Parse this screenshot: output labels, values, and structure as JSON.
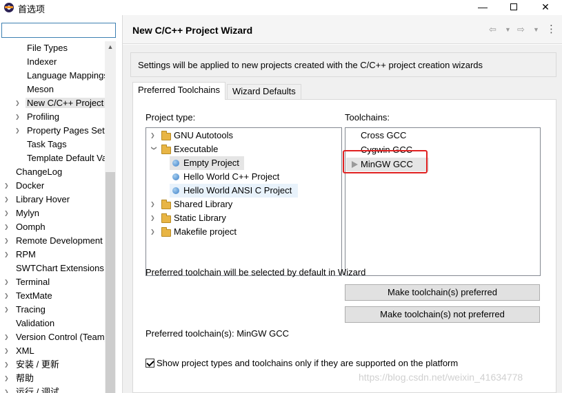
{
  "window": {
    "title": "首选项",
    "minimize_glyph": "—",
    "close_glyph": "✕"
  },
  "filter": {
    "value": "",
    "placeholder": ""
  },
  "sidebar": {
    "items": [
      {
        "label": "File Types",
        "indent": 1,
        "arrow": "",
        "selected": false
      },
      {
        "label": "Indexer",
        "indent": 1,
        "arrow": "",
        "selected": false
      },
      {
        "label": "Language Mappings",
        "indent": 1,
        "arrow": "",
        "selected": false
      },
      {
        "label": "Meson",
        "indent": 1,
        "arrow": "",
        "selected": false
      },
      {
        "label": "New C/C++ Project Wizard",
        "indent": 1,
        "arrow": ">",
        "selected": true
      },
      {
        "label": "Profiling",
        "indent": 1,
        "arrow": ">",
        "selected": false
      },
      {
        "label": "Property Pages Settings",
        "indent": 1,
        "arrow": ">",
        "selected": false
      },
      {
        "label": "Task Tags",
        "indent": 1,
        "arrow": "",
        "selected": false
      },
      {
        "label": "Template Default Values",
        "indent": 1,
        "arrow": "",
        "selected": false
      },
      {
        "label": "ChangeLog",
        "indent": 0,
        "arrow": "",
        "selected": false
      },
      {
        "label": "Docker",
        "indent": 0,
        "arrow": ">",
        "selected": false
      },
      {
        "label": "Library Hover",
        "indent": 0,
        "arrow": ">",
        "selected": false
      },
      {
        "label": "Mylyn",
        "indent": 0,
        "arrow": ">",
        "selected": false
      },
      {
        "label": "Oomph",
        "indent": 0,
        "arrow": ">",
        "selected": false
      },
      {
        "label": "Remote Development",
        "indent": 0,
        "arrow": ">",
        "selected": false
      },
      {
        "label": "RPM",
        "indent": 0,
        "arrow": ">",
        "selected": false
      },
      {
        "label": "SWTChart Extensions",
        "indent": 0,
        "arrow": "",
        "selected": false
      },
      {
        "label": "Terminal",
        "indent": 0,
        "arrow": ">",
        "selected": false
      },
      {
        "label": "TextMate",
        "indent": 0,
        "arrow": ">",
        "selected": false
      },
      {
        "label": "Tracing",
        "indent": 0,
        "arrow": ">",
        "selected": false
      },
      {
        "label": "Validation",
        "indent": 0,
        "arrow": "",
        "selected": false
      },
      {
        "label": "Version Control (Team)",
        "indent": 0,
        "arrow": ">",
        "selected": false
      },
      {
        "label": "XML",
        "indent": 0,
        "arrow": ">",
        "selected": false
      },
      {
        "label": "安装 / 更新",
        "indent": 0,
        "arrow": ">",
        "selected": false
      },
      {
        "label": "帮助",
        "indent": 0,
        "arrow": ">",
        "selected": false
      },
      {
        "label": "运行 / 调试",
        "indent": 0,
        "arrow": ">",
        "selected": false
      }
    ]
  },
  "page": {
    "title": "New C/C++ Project Wizard",
    "info": "Settings will be applied to new projects created with the C/C++ project creation wizards"
  },
  "tabs": [
    {
      "label": "Preferred Toolchains",
      "active": true
    },
    {
      "label": "Wizard Defaults",
      "active": false
    }
  ],
  "project_type": {
    "label": "Project type:",
    "items": [
      {
        "label": "GNU Autotools",
        "kind": "folder",
        "arrow": ">",
        "level": 0,
        "highlight": ""
      },
      {
        "label": "Executable",
        "kind": "folder",
        "arrow": "v",
        "level": 0,
        "highlight": ""
      },
      {
        "label": "Empty Project",
        "kind": "leaf",
        "arrow": "",
        "level": 1,
        "highlight": "gray"
      },
      {
        "label": "Hello World C++ Project",
        "kind": "leaf",
        "arrow": "",
        "level": 1,
        "highlight": ""
      },
      {
        "label": "Hello World ANSI C Project",
        "kind": "leaf",
        "arrow": "",
        "level": 1,
        "highlight": "blue"
      },
      {
        "label": "Shared Library",
        "kind": "folder",
        "arrow": ">",
        "level": 0,
        "highlight": ""
      },
      {
        "label": "Static Library",
        "kind": "folder",
        "arrow": ">",
        "level": 0,
        "highlight": ""
      },
      {
        "label": "Makefile project",
        "kind": "folder",
        "arrow": ">",
        "level": 0,
        "highlight": ""
      }
    ]
  },
  "toolchains": {
    "label": "Toolchains:",
    "items": [
      "Cross GCC",
      "Cygwin GCC",
      "MinGW GCC"
    ],
    "selected": "MinGW GCC"
  },
  "preferred_note": "Preferred toolchain will be selected by default in Wizard",
  "buttons": {
    "make_preferred": "Make toolchain(s) preferred",
    "make_not_preferred": "Make toolchain(s) not preferred"
  },
  "preferred_toolchains": "Preferred toolchain(s): MinGW GCC",
  "show_supported": {
    "label": "Show project types and toolchains only if they are supported on the platform",
    "checked": true
  },
  "watermark": "https://blog.csdn.net/weixin_41634778",
  "colors": {
    "highlight_red": "#e02020",
    "selection_gray": "#e5e5e5",
    "selection_blue": "#e8f2fb"
  }
}
